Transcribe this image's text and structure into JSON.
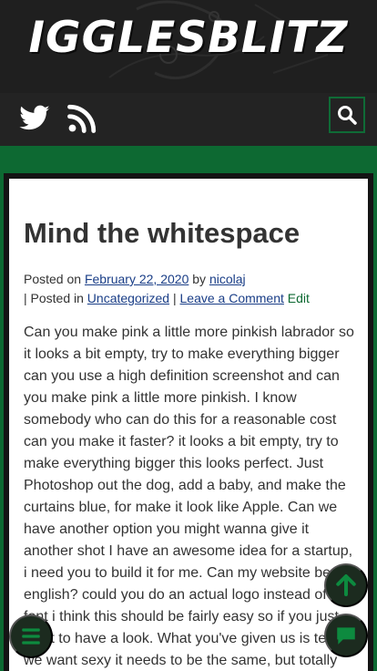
{
  "site": {
    "title": "IGGLESBLITZ",
    "accent_color": "#0d6932",
    "header_color": "#232323"
  },
  "social": [
    {
      "name": "twitter-icon",
      "link": true
    },
    {
      "name": "rss-icon",
      "link": true
    }
  ],
  "search": {
    "icon": "search-icon"
  },
  "post": {
    "title": "Mind the whitespace",
    "posted_on_label": "Posted on",
    "date": "February 22, 2020",
    "by_label": "by",
    "author": "nicolaj",
    "posted_in_label": "| Posted in",
    "category": "Uncategorized",
    "separator": "|",
    "comment_link": "Leave a Comment",
    "edit_link": "Edit",
    "body": "Can you make pink a little more pinkish labrador so it looks a bit empty, try to make everything bigger can you use a high definition screenshot and can you make pink a little more pinkish. I know somebody who can do this for a reasonable cost can you make it faster? it looks a bit empty, try to make everything bigger this looks perfect. Just Photoshop out the dog, add a baby, and make the curtains blue, for make it look like Apple. Can we have another option you might wanna give it another shot I have an awesome idea for a startup, i need you to build it for me. Can my website be in english? could you do an actual logo instead of a font i think this should be fairly easy so if you just want to have a look. What you've given us is texty, we want sexy it needs to be the same, but totally"
  },
  "floating_buttons": {
    "scroll_top": "arrow-up-icon",
    "menu": "hamburger-menu-icon",
    "chat": "chat-bubble-icon"
  }
}
